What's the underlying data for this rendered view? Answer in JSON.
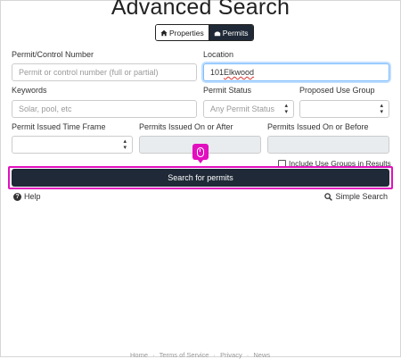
{
  "page": {
    "title": "Advanced Search"
  },
  "toggle": {
    "properties": "Properties",
    "permits": "Permits"
  },
  "form": {
    "permit_number": {
      "label": "Permit/Control Number",
      "placeholder": "Permit or control number (full or partial)"
    },
    "location": {
      "label": "Location",
      "value_number": "101 ",
      "value_street": "Elkwood"
    },
    "keywords": {
      "label": "Keywords",
      "placeholder": "Solar, pool, etc"
    },
    "permit_status": {
      "label": "Permit Status",
      "selected": "Any Permit Status"
    },
    "proposed_use": {
      "label": "Proposed Use Group",
      "selected": ""
    },
    "time_frame": {
      "label": "Permit Issued Time Frame",
      "selected": ""
    },
    "issued_after": {
      "label": "Permits Issued On or After",
      "value": ""
    },
    "issued_before": {
      "label": "Permits Issued On or Before",
      "value": ""
    },
    "include_use_groups": {
      "label": "Include Use Groups in Results",
      "checked": false
    },
    "search_button": "Search for permits"
  },
  "links": {
    "help": "Help",
    "simple_search": "Simple Search"
  },
  "footer": {
    "items": [
      "Home",
      "Terms of Service",
      "Privacy",
      "News"
    ]
  },
  "colors": {
    "accent_dark": "#1f2937",
    "highlight": "#e20fbf",
    "focus": "#80bdff"
  }
}
